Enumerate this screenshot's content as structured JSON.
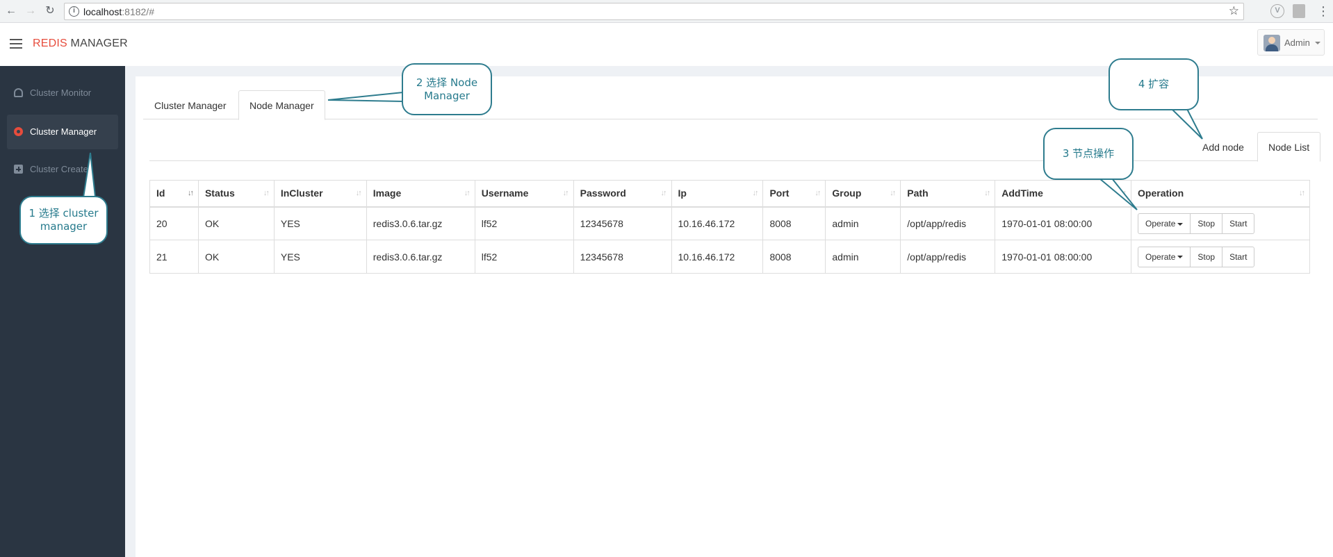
{
  "browser": {
    "url_host": "localhost",
    "url_rest": ":8182/#",
    "back_icon": "arrow-left-icon",
    "forward_icon": "arrow-right-icon",
    "reload_icon": "reload-icon",
    "star_icon": "star-icon",
    "ext_v_label": "V"
  },
  "header": {
    "brand_red": "REDIS",
    "brand_dark": " MANAGER",
    "user_name": "Admin"
  },
  "sidebar": {
    "items": [
      {
        "label": "Cluster Monitor",
        "icon": "dashboard-icon"
      },
      {
        "label": "Cluster Manager",
        "icon": "gear-icon"
      },
      {
        "label": "Cluster Create",
        "icon": "plus-square-icon"
      }
    ]
  },
  "tabs": [
    {
      "label": "Cluster Manager"
    },
    {
      "label": "Node Manager"
    }
  ],
  "subtabs": [
    {
      "label": "Add node"
    },
    {
      "label": "Node List"
    }
  ],
  "table": {
    "columns": [
      "Id",
      "Status",
      "InCluster",
      "Image",
      "Username",
      "Password",
      "Ip",
      "Port",
      "Group",
      "Path",
      "AddTime",
      "Operation"
    ],
    "rows": [
      {
        "id": "20",
        "status": "OK",
        "incluster": "YES",
        "image": "redis3.0.6.tar.gz",
        "username": "lf52",
        "password": "12345678",
        "ip": "10.16.46.172",
        "port": "8008",
        "group": "admin",
        "path": "/opt/app/redis",
        "addtime": "1970-01-01 08:00:00"
      },
      {
        "id": "21",
        "status": "OK",
        "incluster": "YES",
        "image": "redis3.0.6.tar.gz",
        "username": "lf52",
        "password": "12345678",
        "ip": "10.16.46.172",
        "port": "8008",
        "group": "admin",
        "path": "/opt/app/redis",
        "addtime": "1970-01-01 08:00:00"
      }
    ],
    "buttons": {
      "operate": "Operate",
      "stop": "Stop",
      "start": "Start"
    }
  },
  "callouts": {
    "c1_line1": "1 选择  cluster",
    "c1_line2": "manager",
    "c2_line1": "2 选择  Node",
    "c2_line2": "Manager",
    "c3": "3 节点操作",
    "c4": "4 扩容"
  },
  "colors": {
    "brand_red": "#e74c3c",
    "sidebar_bg": "#2a3542",
    "callout": "#2e7c8e"
  }
}
